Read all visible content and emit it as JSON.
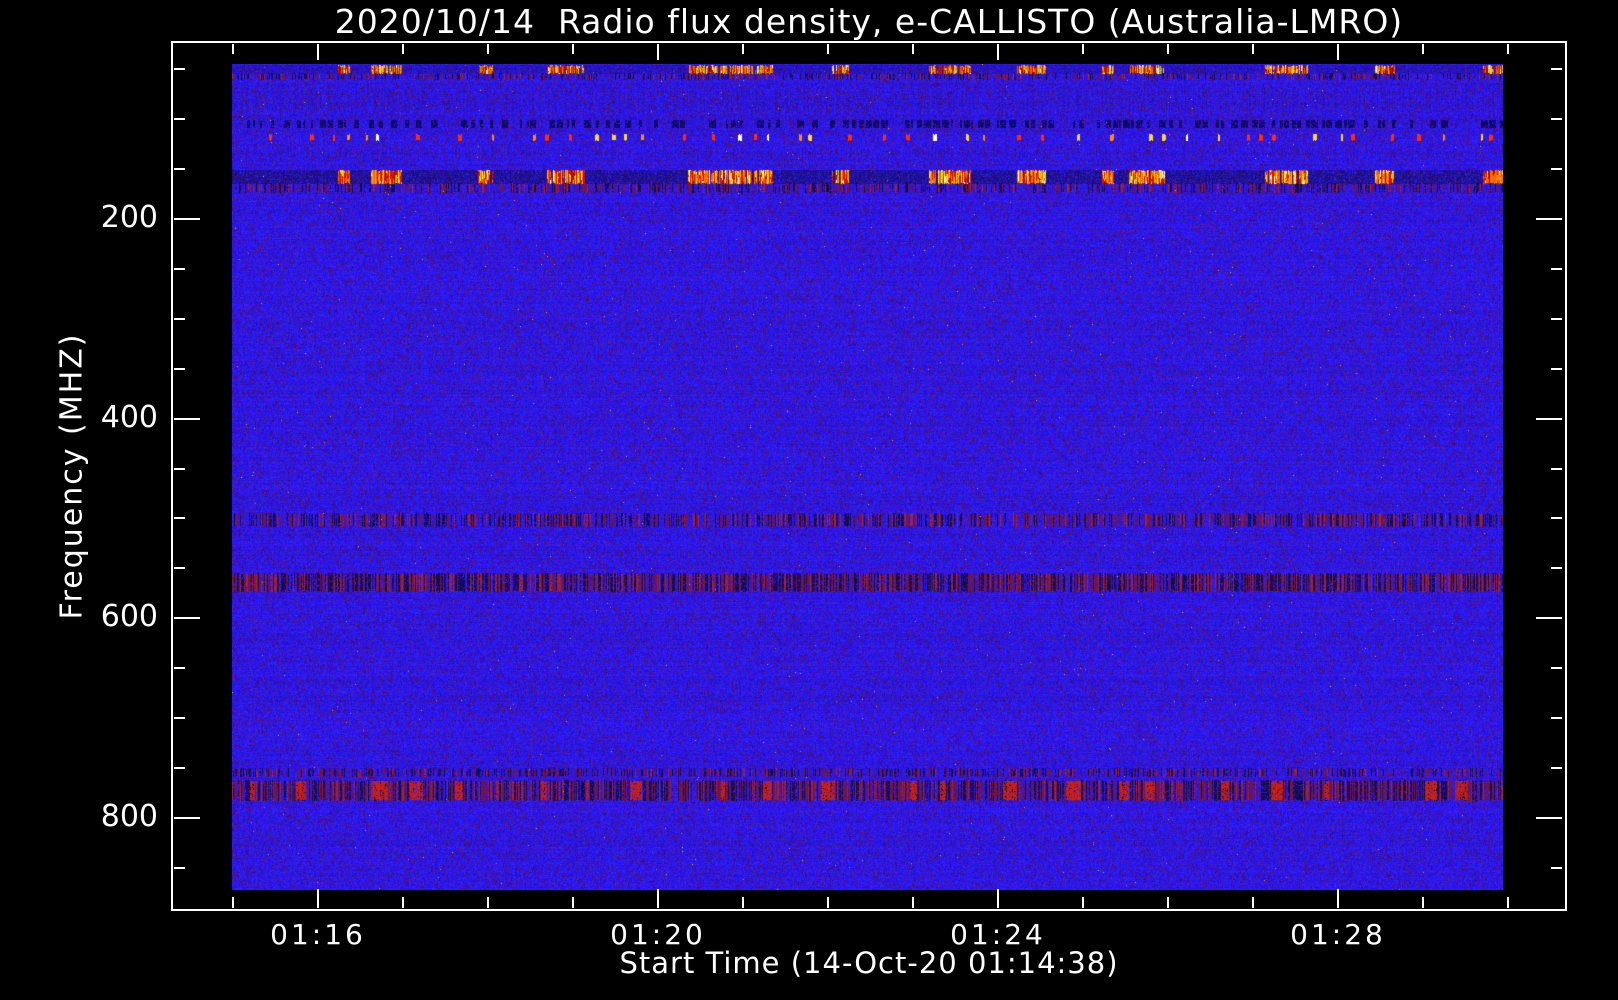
{
  "chart_data": {
    "type": "heatmap",
    "subtype": "radio-spectrogram",
    "title": "2020/10/14  Radio flux density, e-CALLISTO (Australia-LMRO)",
    "xlabel": "Start Time (14-Oct-20 01:14:38)",
    "ylabel": "Frequency (MHZ)",
    "x_axis": {
      "start_time": "01:14:38",
      "major_tick_labels": [
        "01:16",
        "01:20",
        "01:24",
        "01:28"
      ],
      "major_tick_interval_min": 4,
      "minor_tick_interval_min": 1,
      "first_minor_tick": "01:15",
      "last_minor_tick": "01:30"
    },
    "y_axis": {
      "major_ticks_mhz": [
        200,
        400,
        600,
        800
      ],
      "major_tick_labels": [
        "200",
        "400",
        "600",
        "800"
      ],
      "minor_tick_step_mhz": 50,
      "range_mhz": [
        45,
        872
      ],
      "direction": "increasing-downward"
    },
    "colors": {
      "page_background": "#000000",
      "axis": "#ffffff",
      "text": "#ffffff",
      "base_blue": "#2a19ec",
      "streak_purple": "#501690",
      "gap_navy": "#0a0a3c",
      "burst_palette": [
        "#c81400",
        "#ff6400",
        "#ffaa00",
        "#ffe150",
        "#a00a05",
        "#b4dc1e",
        "#ffffff"
      ],
      "speckle_palette": [
        "#821c1c",
        "#be2312",
        "#190837",
        "#080828"
      ]
    },
    "bands": [
      {
        "name": "rfi-burst-band-45mhz",
        "mhz_from": 46,
        "mhz_to": 54,
        "style": "bursts",
        "density": 0.92
      },
      {
        "name": "rfi-burst-shadow-45mhz",
        "mhz_from": 54,
        "mhz_to": 60,
        "style": "dark-red-speckle",
        "density": 0.4
      },
      {
        "name": "faint-speckle-80mhz",
        "mhz_from": 69,
        "mhz_to": 95,
        "style": "faint-dark",
        "density": 0.3
      },
      {
        "name": "dark-dash-line-104mhz",
        "mhz_from": 101,
        "mhz_to": 108,
        "style": "dark-dashes",
        "density": 0.5
      },
      {
        "name": "bright-dot-line-118mhz",
        "mhz_from": 115,
        "mhz_to": 121,
        "style": "bright-dots",
        "density": 0.12
      },
      {
        "name": "faint-speckle-132mhz",
        "mhz_from": 127,
        "mhz_to": 138,
        "style": "faint-dark",
        "density": 0.25
      },
      {
        "name": "rfi-burst-band-157mhz",
        "mhz_from": 151,
        "mhz_to": 164,
        "style": "bursts",
        "density": 1.05
      },
      {
        "name": "rfi-burst-shadow-157mhz",
        "mhz_from": 164,
        "mhz_to": 173,
        "style": "dark-red-speckle",
        "density": 0.45
      },
      {
        "name": "speckle-band-500mhz",
        "mhz_from": 494,
        "mhz_to": 508,
        "style": "dark-red-speckle",
        "density": 0.6
      },
      {
        "name": "speckle-band-564mhz",
        "mhz_from": 555,
        "mhz_to": 573,
        "style": "dark-red-speckle",
        "density": 0.85
      },
      {
        "name": "speckle-line-754mhz",
        "mhz_from": 750,
        "mhz_to": 758,
        "style": "dark-red-speckle",
        "density": 0.5
      },
      {
        "name": "speckle-band-772mhz",
        "mhz_from": 762,
        "mhz_to": 782,
        "style": "red-blob-speckle",
        "density": 0.85
      }
    ]
  }
}
